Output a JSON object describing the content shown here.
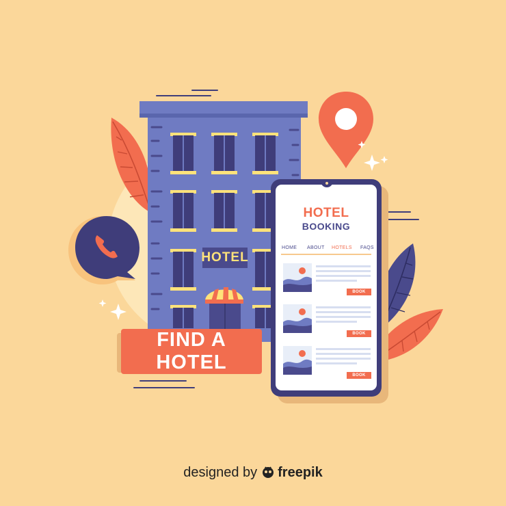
{
  "building": {
    "sign": "HOTEL"
  },
  "cta": {
    "label": "FIND A HOTEL"
  },
  "phone": {
    "title": "HOTEL",
    "subtitle": "BOOKING",
    "nav": [
      "HOME",
      "ABOUT",
      "HOTELS",
      "FAQS"
    ],
    "active_nav": "HOTELS",
    "listings": [
      {
        "button": "BOOK"
      },
      {
        "button": "BOOK"
      },
      {
        "button": "BOOK"
      }
    ]
  },
  "credit": {
    "prefix": "designed by",
    "brand": "freepik"
  },
  "colors": {
    "background": "#fbd79a",
    "accent": "#f26d4f",
    "navy": "#4a4a8c",
    "building": "#6f7bc2",
    "window": "#ffe27a"
  }
}
